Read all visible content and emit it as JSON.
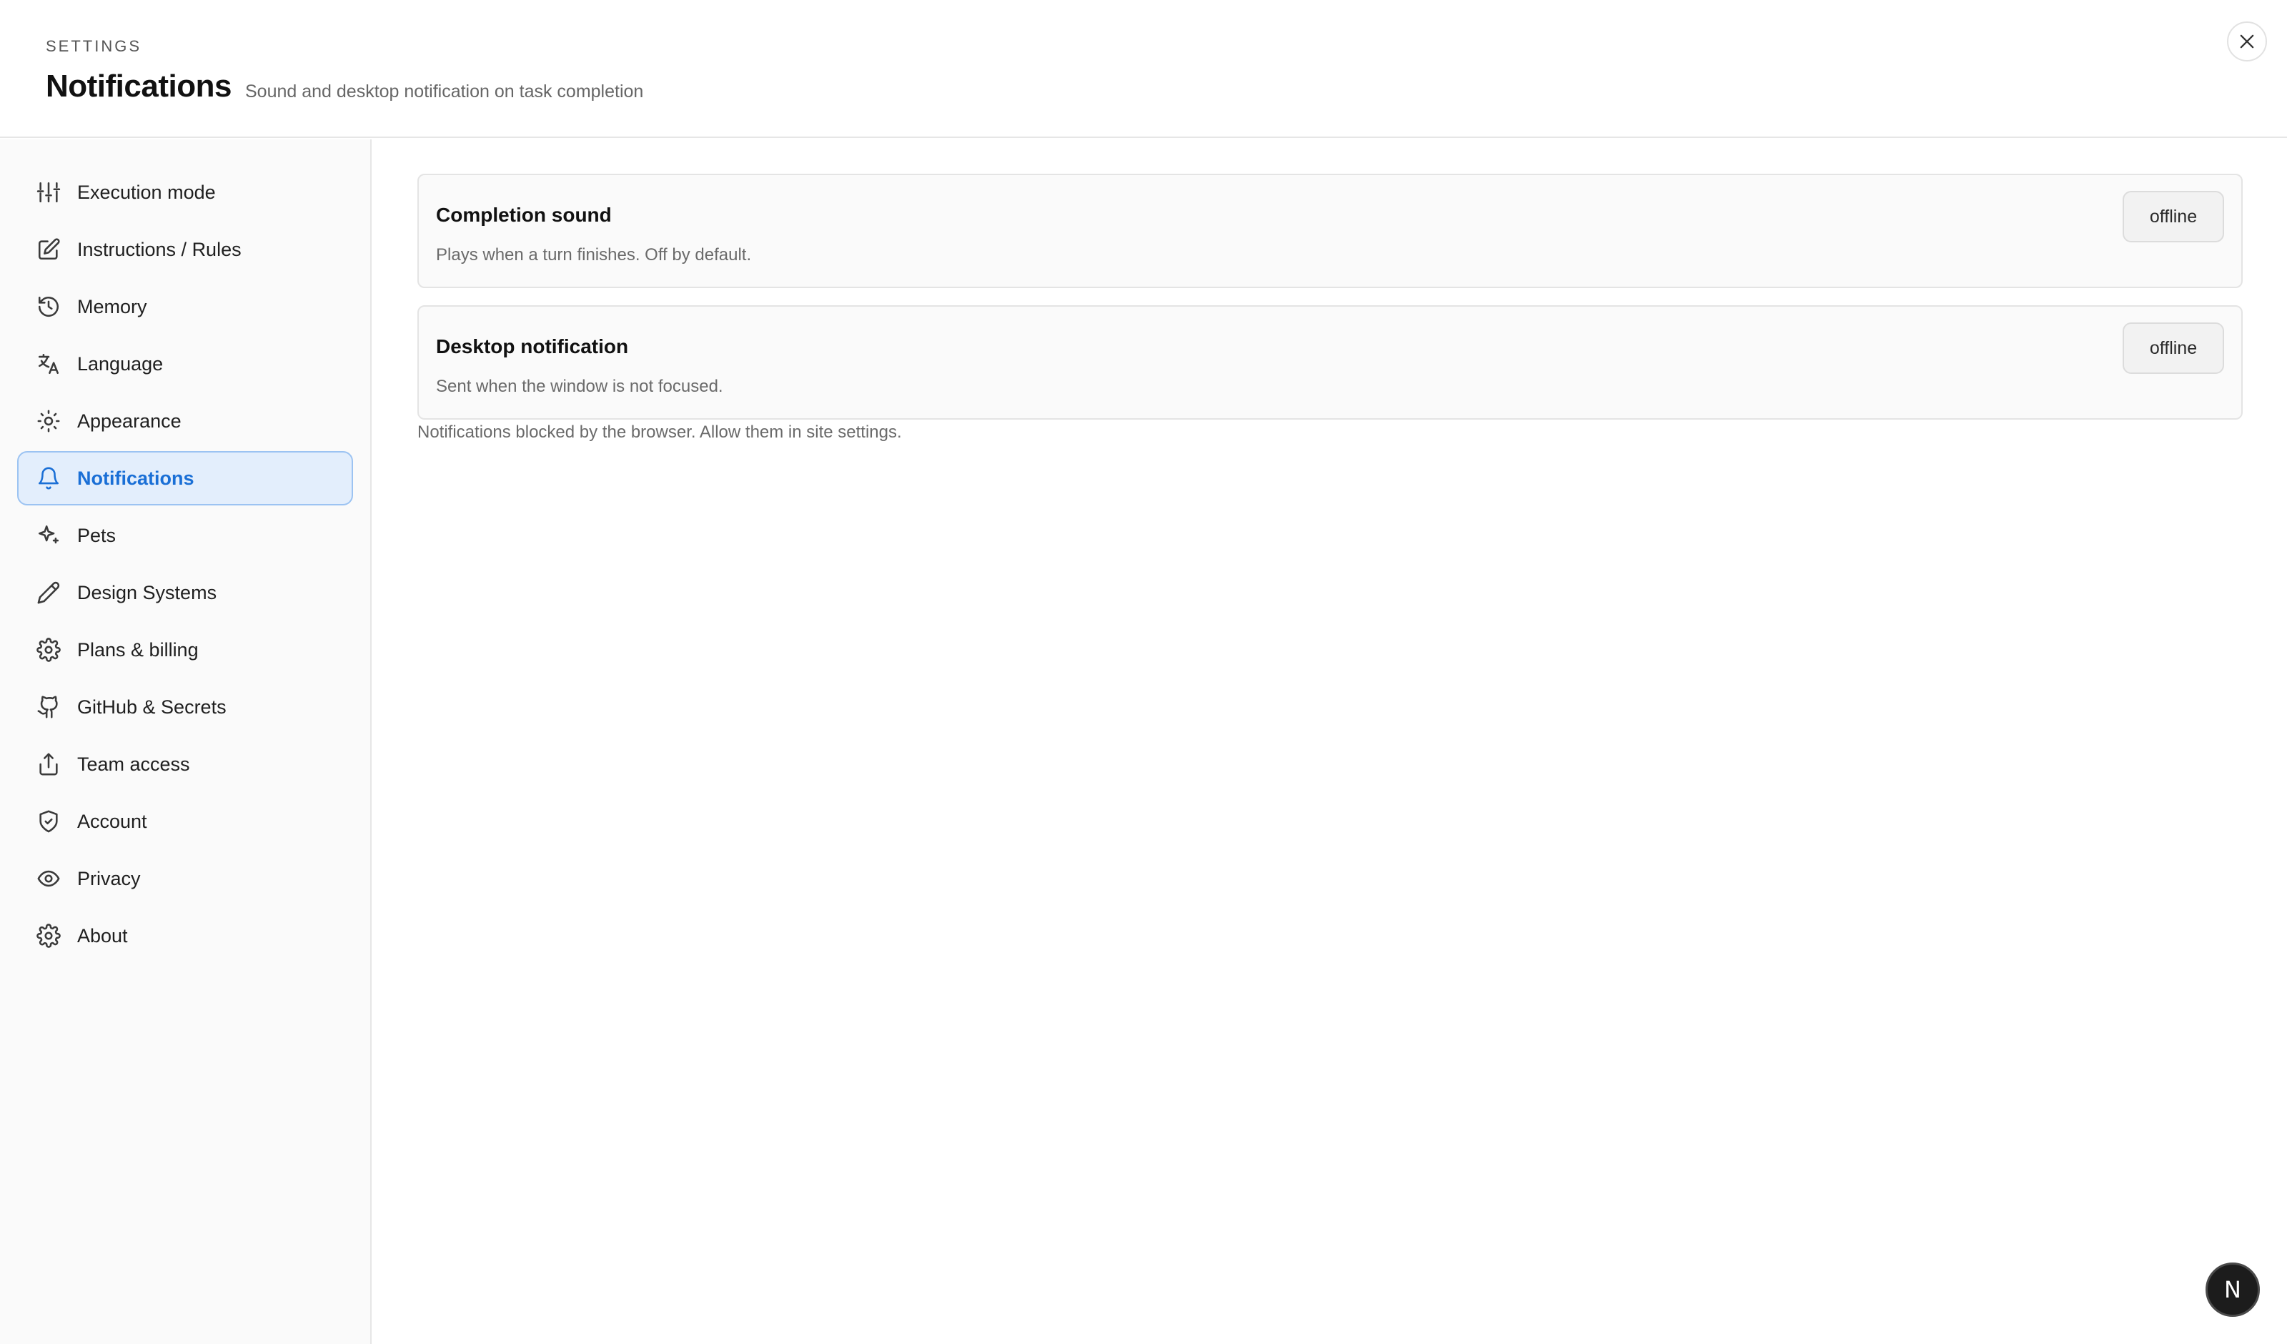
{
  "header": {
    "eyebrow": "SETTINGS",
    "title": "Notifications",
    "subtitle": "Sound and desktop notification on task completion",
    "close_icon": "close-icon"
  },
  "sidebar": {
    "items": [
      {
        "label": "Execution mode",
        "icon": "sliders-icon"
      },
      {
        "label": "Instructions / Rules",
        "icon": "edit-icon"
      },
      {
        "label": "Memory",
        "icon": "history-icon"
      },
      {
        "label": "Language",
        "icon": "translate-icon"
      },
      {
        "label": "Appearance",
        "icon": "sun-icon"
      },
      {
        "label": "Notifications",
        "icon": "bell-icon",
        "active": true
      },
      {
        "label": "Pets",
        "icon": "sparkles-icon"
      },
      {
        "label": "Design Systems",
        "icon": "pencil-icon"
      },
      {
        "label": "Plans & billing",
        "icon": "gear-icon"
      },
      {
        "label": "GitHub & Secrets",
        "icon": "github-icon"
      },
      {
        "label": "Team access",
        "icon": "share-icon"
      },
      {
        "label": "Account",
        "icon": "shield-icon"
      },
      {
        "label": "Privacy",
        "icon": "eye-icon"
      },
      {
        "label": "About",
        "icon": "gear-icon"
      }
    ]
  },
  "main": {
    "cards": [
      {
        "title": "Completion sound",
        "description": "Plays when a turn finishes. Off by default.",
        "status": "offline"
      },
      {
        "title": "Desktop notification",
        "description": "Sent when the window is not focused.",
        "status": "offline"
      }
    ],
    "note": "Notifications blocked by the browser. Allow them in site settings."
  },
  "fab": {
    "label": "N"
  },
  "colors": {
    "accent": "#1a6fd6",
    "active_bg": "#e3eefc",
    "active_border": "#9cc3f2",
    "sidebar_bg": "#fafafa"
  }
}
